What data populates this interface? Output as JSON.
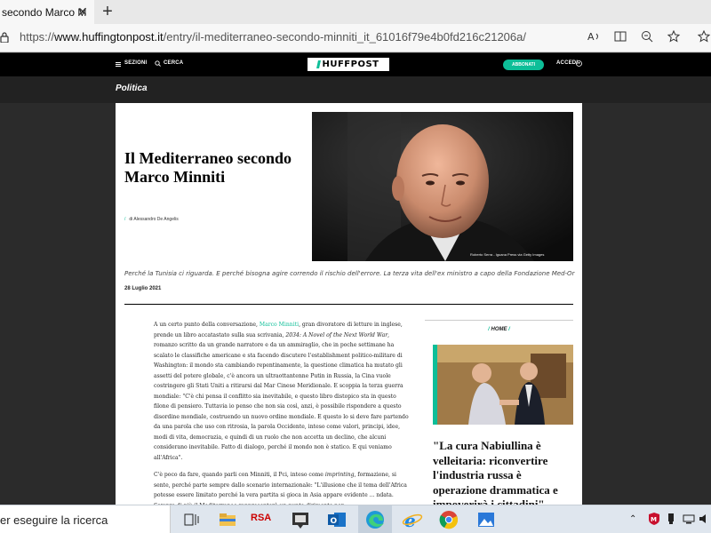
{
  "browser": {
    "tab_title": "secondo Marco M",
    "tab_close": "✕",
    "new_tab": "+",
    "url_prefix": "https://",
    "url_host": "www.huffingtonpost.it",
    "url_path": "/entry/il-mediterraneo-secondo-minniti_it_61016f79e4b0fd216c21206a/"
  },
  "site": {
    "menu_label": "SEZIONI",
    "search_label": "CERCA",
    "logo_text": "HUFFPOST",
    "subscribe_label": "ABBONATI",
    "login_label": "ACCEDI",
    "section": "Politica",
    "accent_color": "#0dbe98"
  },
  "article": {
    "headline": "Il Mediterraneo secondo Marco Minniti",
    "byline": "di Alessandro De Angelis",
    "photo_caption": "Roberto Serra - Iguana Press via Getty Images",
    "dek": "Perché la Tunisia ci riguarda. E perché bisogna agire correndo il rischio dell'errore. La terza vita dell'ex ministro a capo della Fondazione Med-Or",
    "date": "28 Luglio 2021",
    "p1_a": "A un certo punto della conversazione, ",
    "p1_link": "Marco Minniti",
    "p1_b": ", gran divoratore di letture in inglese, prende un libro accatastato sulla sua scrivania, ",
    "p1_title": "2034: A Novel of the Next World War",
    "p1_c": ", romanzo scritto da un grande narratore e da un ammiraglio, che in poche settimane ha scalato le classifiche americane e sta facendo discutere l'establishment politico-militare di Washington: il mondo sta cambiando repentinamente, la questione climatica ha mutato gli assetti del potere globale, c'è ancora un ultraottantenne Putin in Russia, la Cina vuole costringere gli Stati Uniti a ritirarsi dal Mar Cinese Meridionale. E scoppia la terza guerra mondiale: \"C'è chi pensa il conflitto sia inevitabile, e questo libro distopico sta in questo filone di pensiero. Tuttavia io penso che non sia così, anzi, è possibile rispondere a questo disordine mondiale, costruendo un nuovo ordine mondiale. E questo lo si deve fare partendo da una parola che uso con ritrosia, la parola Occidente, inteso come valori, principi, idee, modi di vita, democrazia, e quindi di un ruolo che non accetta un declino, che alcuni considerano inevitabile. Fatto di dialogo, perché il mondo non è statico. E qui veniamo all'Africa\".",
    "p2_a": "C'è poco da fare, quando parli con Minniti, il Pci, inteso come ",
    "p2_em": "imprinting",
    "p2_b": ", formazione, si sente, perché parte sempre dallo scenario internazionale: \"L'illusione che il tema dell'Africa potesse essere limitato perché la vera partita si gioca in Asia appare evidente ... ndata. Sempre di più il Mediterraneo rappresenterà un punto dirimente per"
  },
  "sidebar": {
    "label": "HOME",
    "headline": "\"La cura Nabiullina è velleitaria: riconvertire l'industria russa è operazione drammatica e impoverirà i cittadini\""
  },
  "taskbar": {
    "search_text": "er eseguire la ricerca",
    "rsa_label": "RSA"
  }
}
